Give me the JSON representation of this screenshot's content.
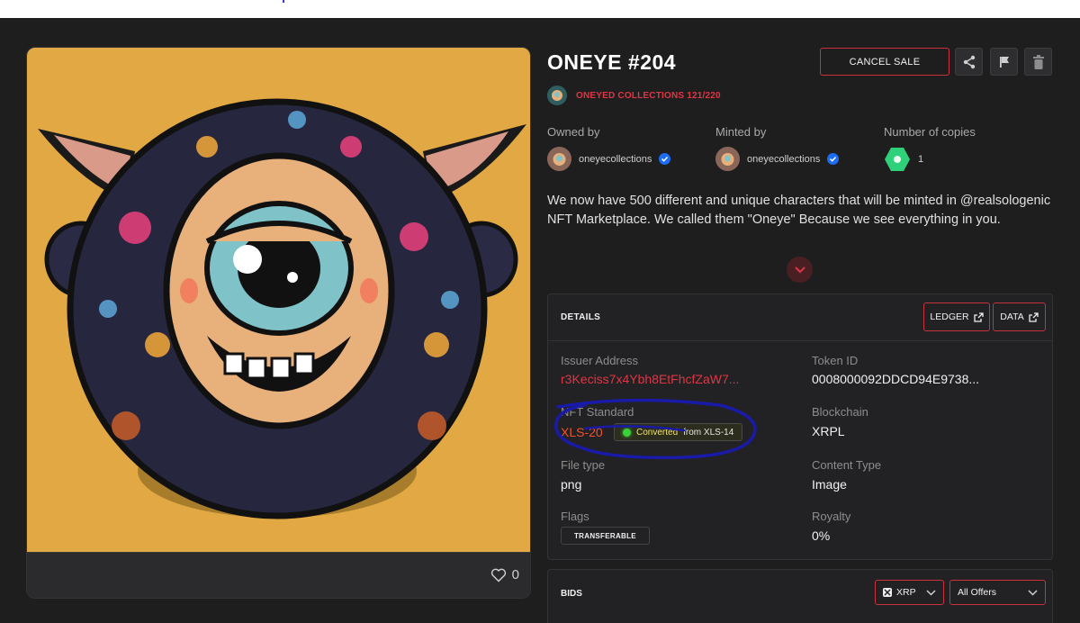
{
  "nft": {
    "title": "ONEYE #204",
    "collection": "ONEYED COLLECTIONS 121/220",
    "description": "We now have 500 different and unique characters that will be minted in @realsologenic NFT Marketplace. We called them \"Oneye\" Because we see everything in you.",
    "likes": "0"
  },
  "actions": {
    "cancel_sale": "CANCEL SALE",
    "share_icon": "share-icon",
    "flag_icon": "flag-icon",
    "delete_icon": "trash-icon"
  },
  "meta": {
    "owned_label": "Owned by",
    "owned_value": "oneyecollections",
    "minted_label": "Minted by",
    "minted_value": "oneyecollections",
    "copies_label": "Number of copies",
    "copies_value": "1"
  },
  "details": {
    "title": "DETAILS",
    "ledger_label": "LEDGER",
    "data_label": "DATA",
    "issuer_label": "Issuer Address",
    "issuer_value": "r3Keciss7x4Ybh8EtFhcfZaW7...",
    "token_label": "Token ID",
    "token_value": "0008000092DDCD94E9738...",
    "standard_label": "NFT Standard",
    "standard_value": "XLS-20",
    "converted_highlight": "Converted",
    "converted_rest": "from XLS-14",
    "blockchain_label": "Blockchain",
    "blockchain_value": "XRPL",
    "filetype_label": "File type",
    "filetype_value": "png",
    "contenttype_label": "Content Type",
    "contenttype_value": "Image",
    "flags_label": "Flags",
    "flags_value": "TRANSFERABLE",
    "royalty_label": "Royalty",
    "royalty_value": "0%"
  },
  "bids": {
    "title": "BIDS",
    "currency": "XRP",
    "filter": "All Offers"
  },
  "colors": {
    "accent": "#e03545",
    "background": "#1e1e1f",
    "artwork_bg": "#e2a843"
  }
}
